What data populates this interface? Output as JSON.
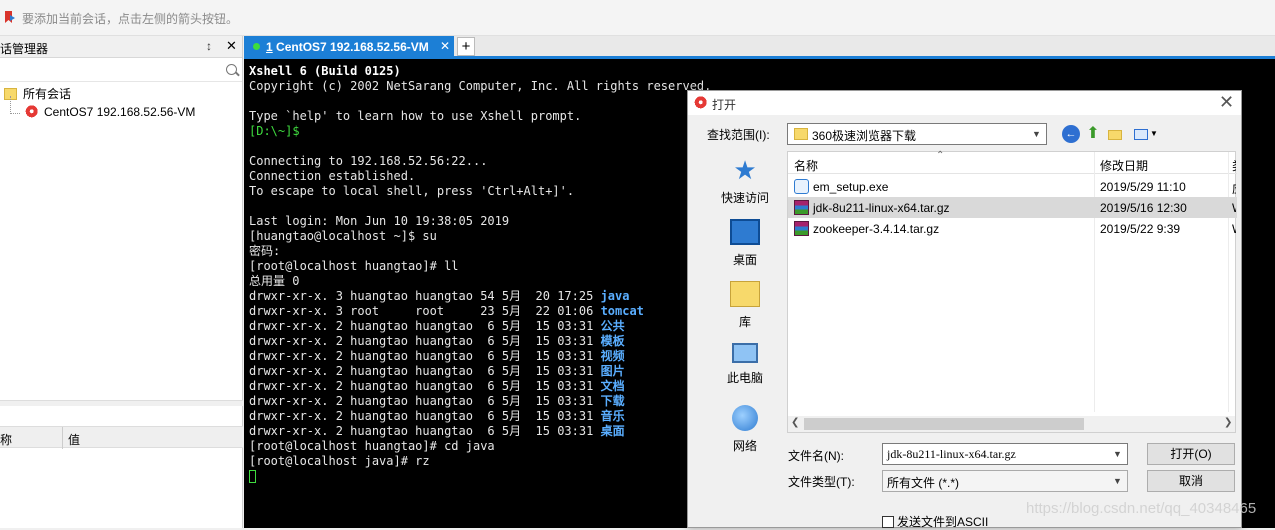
{
  "topbar": {
    "hint": "要添加当前会话，点击左侧的箭头按钮。"
  },
  "session_manager": {
    "title": "话管理器",
    "tree": {
      "root": "所有会话",
      "child": "CentOS7 192.168.52.56-VM"
    },
    "props": {
      "col_name": "称",
      "col_value": "值"
    }
  },
  "tabs": [
    {
      "index": "1",
      "label": "CentOS7 192.168.52.56-VM"
    }
  ],
  "terminal": {
    "lines": [
      {
        "t": "Xshell 6 (Build 0125)",
        "c": "bold"
      },
      {
        "t": "Copyright (c) 2002 NetSarang Computer, Inc. All rights reserved.",
        "c": ""
      },
      {
        "t": "",
        "c": ""
      },
      {
        "t": "Type `help' to learn how to use Xshell prompt.",
        "c": ""
      },
      {
        "t": "[D:\\~]$",
        "c": "green"
      },
      {
        "t": "",
        "c": ""
      },
      {
        "t": "Connecting to 192.168.52.56:22...",
        "c": ""
      },
      {
        "t": "Connection established.",
        "c": ""
      },
      {
        "t": "To escape to local shell, press 'Ctrl+Alt+]'.",
        "c": ""
      },
      {
        "t": "",
        "c": ""
      },
      {
        "t": "Last login: Mon Jun 10 19:38:05 2019",
        "c": ""
      },
      {
        "t": "[huangtao@localhost ~]$ su",
        "c": ""
      },
      {
        "t": "密码:",
        "c": ""
      },
      {
        "t": "[root@localhost huangtao]# ll",
        "c": ""
      },
      {
        "t": "总用量 0",
        "c": ""
      }
    ],
    "listing": [
      {
        "p": "drwxr-xr-x. 3 huangtao huangtao 54 5月  20 17:25 ",
        "n": "java"
      },
      {
        "p": "drwxr-xr-x. 3 root     root     23 5月  22 01:06 ",
        "n": "tomcat"
      },
      {
        "p": "drwxr-xr-x. 2 huangtao huangtao  6 5月  15 03:31 ",
        "n": "公共"
      },
      {
        "p": "drwxr-xr-x. 2 huangtao huangtao  6 5月  15 03:31 ",
        "n": "模板"
      },
      {
        "p": "drwxr-xr-x. 2 huangtao huangtao  6 5月  15 03:31 ",
        "n": "视频"
      },
      {
        "p": "drwxr-xr-x. 2 huangtao huangtao  6 5月  15 03:31 ",
        "n": "图片"
      },
      {
        "p": "drwxr-xr-x. 2 huangtao huangtao  6 5月  15 03:31 ",
        "n": "文档"
      },
      {
        "p": "drwxr-xr-x. 2 huangtao huangtao  6 5月  15 03:31 ",
        "n": "下载"
      },
      {
        "p": "drwxr-xr-x. 2 huangtao huangtao  6 5月  15 03:31 ",
        "n": "音乐"
      },
      {
        "p": "drwxr-xr-x. 2 huangtao huangtao  6 5月  15 03:31 ",
        "n": "桌面"
      }
    ],
    "tail": [
      "[root@localhost huangtao]# cd java",
      "[root@localhost java]# rz"
    ]
  },
  "dialog": {
    "title": "打开",
    "lookin_label": "查找范围(I):",
    "lookin_value": "360极速浏览器下载",
    "places": [
      "快速访问",
      "桌面",
      "库",
      "此电脑",
      "网络"
    ],
    "columns": {
      "name": "名称",
      "date": "修改日期",
      "more": "类"
    },
    "files": [
      {
        "name": "em_setup.exe",
        "date": "2019/5/29 11:10",
        "more": "应",
        "icon": "exe-icon"
      },
      {
        "name": "jdk-8u211-linux-x64.tar.gz",
        "date": "2019/5/16 12:30",
        "more": "W",
        "icon": "archive-icon"
      },
      {
        "name": "zookeeper-3.4.14.tar.gz",
        "date": "2019/5/22 9:39",
        "more": "W",
        "icon": "archive-icon"
      }
    ],
    "filename_label": "文件名(N):",
    "filename_value": "jdk-8u211-linux-x64.tar.gz",
    "filetype_label": "文件类型(T):",
    "filetype_value": "所有文件 (*.*)",
    "open_button": "打开(O)",
    "cancel_button": "取消",
    "ascii_label": "发送文件到ASCII"
  },
  "watermark": "https://blog.csdn.net/qq_40348465"
}
